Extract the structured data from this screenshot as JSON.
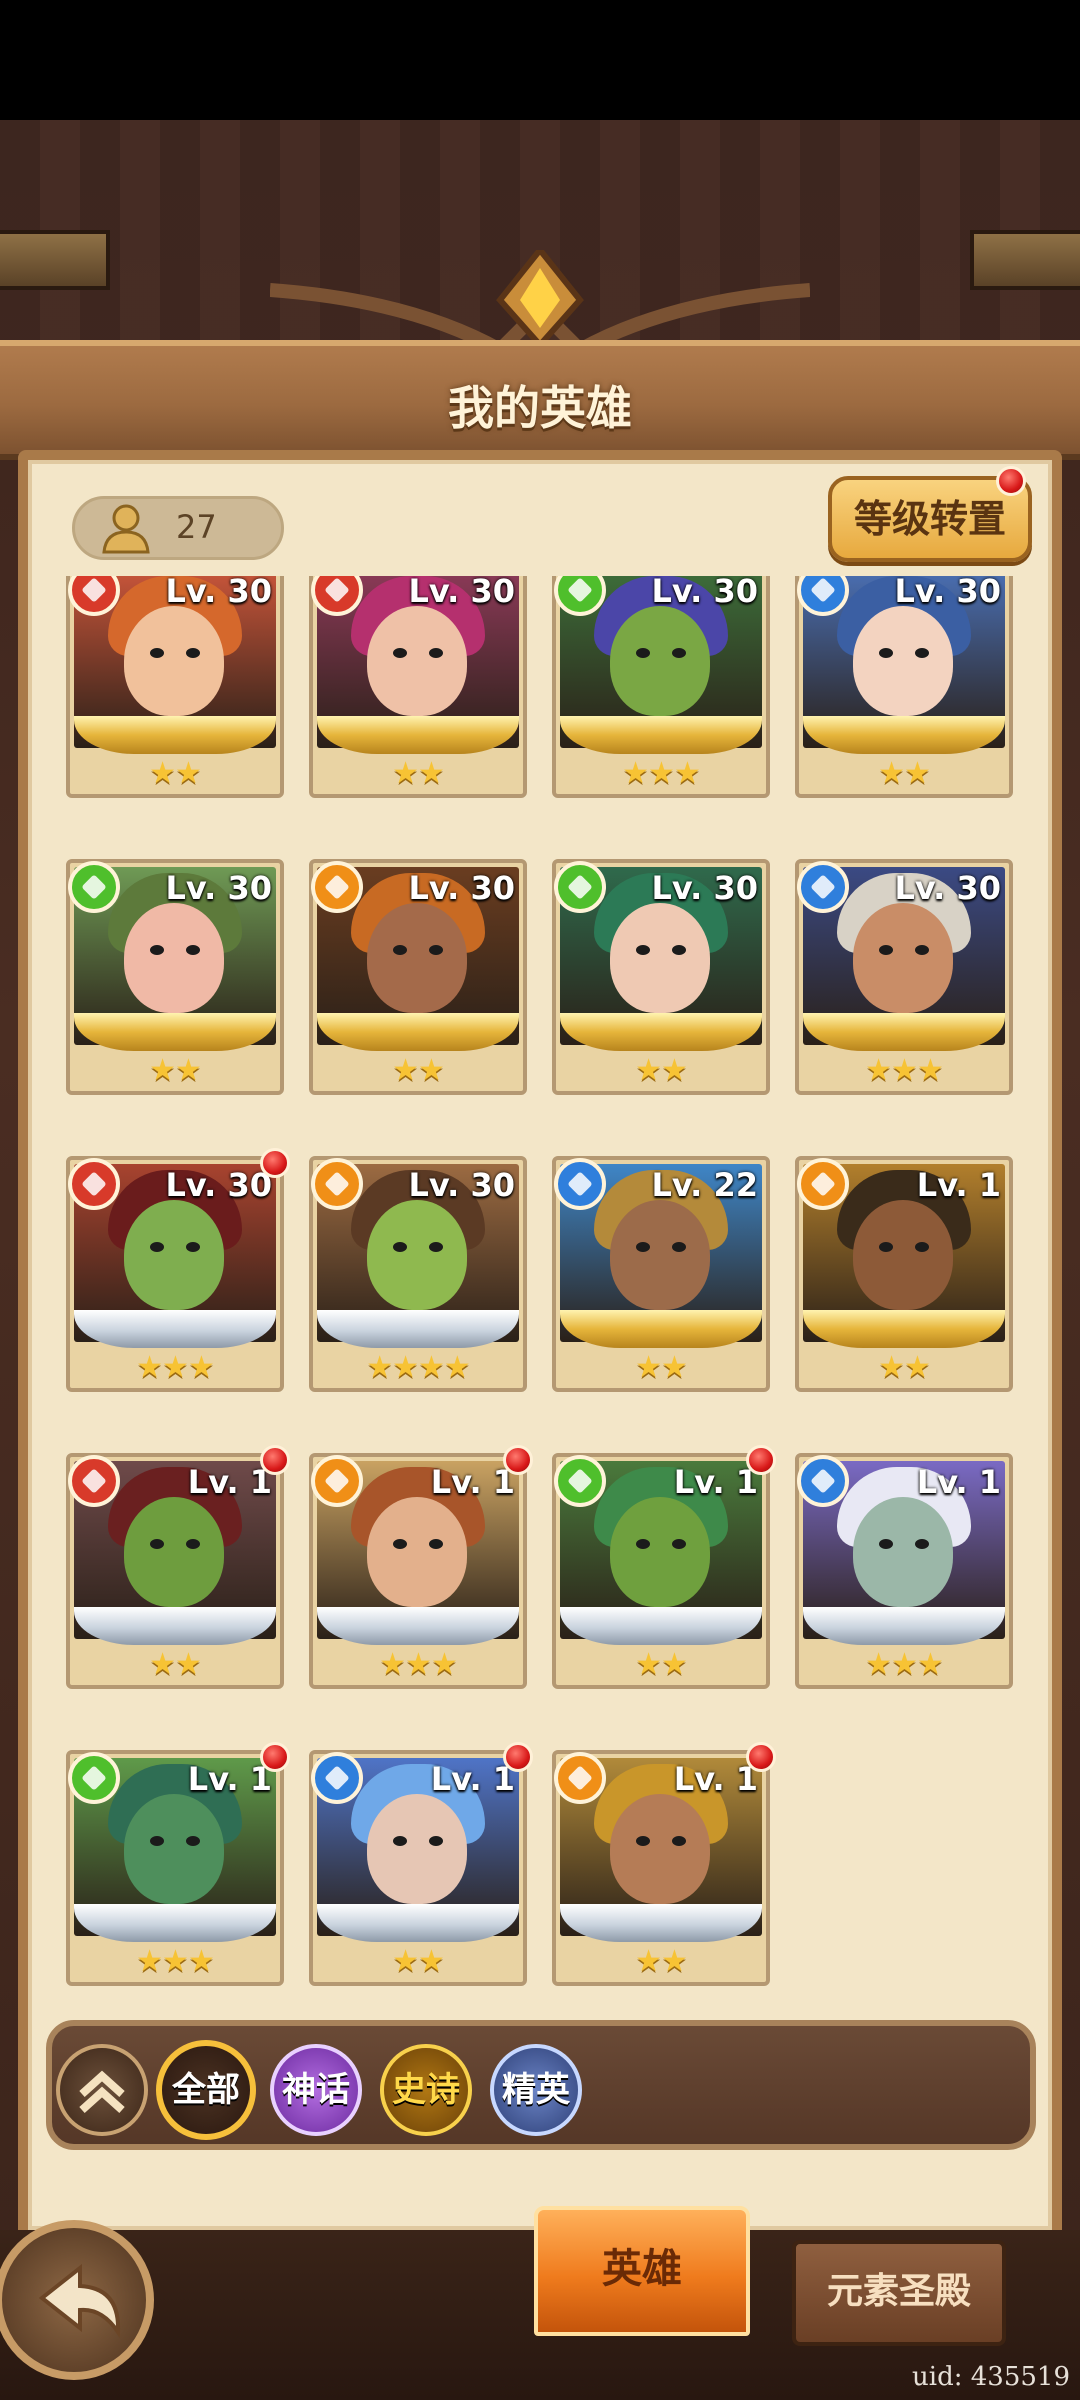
{
  "header": {
    "title": "我的英雄"
  },
  "hero_count": "27",
  "reset_button": {
    "label": "等级转置",
    "has_badge": true
  },
  "elements": {
    "fire": "#d83a2a",
    "earth": "#f08f17",
    "wind": "#4fbf2c",
    "water": "#2f7fdc"
  },
  "heroes": [
    {
      "level": "Lv. 30",
      "element": "fire",
      "stars": "★★",
      "frame": "gold",
      "badge": false,
      "hair": "#d5682c",
      "skin": "#f1c19b",
      "bg": "#c8553a"
    },
    {
      "level": "Lv. 30",
      "element": "fire",
      "stars": "★★",
      "frame": "gold",
      "badge": false,
      "hair": "#b5306e",
      "skin": "#efc1a7",
      "bg": "#8c3a58"
    },
    {
      "level": "Lv. 30",
      "element": "wind",
      "stars": "★★★",
      "frame": "gold",
      "badge": false,
      "hair": "#4b46a8",
      "skin": "#7aa744",
      "bg": "#3d6e3a"
    },
    {
      "level": "Lv. 30",
      "element": "water",
      "stars": "★★",
      "frame": "gold",
      "badge": false,
      "hair": "#3b5fa3",
      "skin": "#f3d3c0",
      "bg": "#4a6fb3"
    },
    {
      "level": "Lv. 30",
      "element": "wind",
      "stars": "★★",
      "frame": "gold",
      "badge": false,
      "hair": "#5d7a3b",
      "skin": "#f0b9a6",
      "bg": "#6f9a55"
    },
    {
      "level": "Lv. 30",
      "element": "earth",
      "stars": "★★",
      "frame": "gold",
      "badge": false,
      "hair": "#c86a23",
      "skin": "#a46a4a",
      "bg": "#6a3d20"
    },
    {
      "level": "Lv. 30",
      "element": "wind",
      "stars": "★★",
      "frame": "gold",
      "badge": false,
      "hair": "#2c7a56",
      "skin": "#efc9b3",
      "bg": "#2f6a4c"
    },
    {
      "level": "Lv. 30",
      "element": "water",
      "stars": "★★★",
      "frame": "gold",
      "badge": false,
      "hair": "#d8d2c6",
      "skin": "#c98d67",
      "bg": "#3b4a84"
    },
    {
      "level": "Lv. 30",
      "element": "fire",
      "stars": "★★★",
      "frame": "silver",
      "badge": true,
      "hair": "#6a1c1c",
      "skin": "#7fae4f",
      "bg": "#a8432f"
    },
    {
      "level": "Lv. 30",
      "element": "earth",
      "stars": "★★★★",
      "frame": "silver",
      "badge": false,
      "hair": "#5b3a24",
      "skin": "#8fb94f",
      "bg": "#9c6b42"
    },
    {
      "level": "Lv. 22",
      "element": "water",
      "stars": "★★",
      "frame": "gold",
      "badge": false,
      "hair": "#b48a3a",
      "skin": "#9c6b4a",
      "bg": "#3f86c7"
    },
    {
      "level": "Lv. 1",
      "element": "earth",
      "stars": "★★",
      "frame": "gold",
      "badge": false,
      "hair": "#3a2b1a",
      "skin": "#8d5a38",
      "bg": "#b27f2c"
    },
    {
      "level": "Lv. 1",
      "element": "fire",
      "stars": "★★",
      "frame": "silver",
      "badge": true,
      "hair": "#6a2020",
      "skin": "#6e9d3e",
      "bg": "#6f4a4a"
    },
    {
      "level": "Lv. 1",
      "element": "earth",
      "stars": "★★★",
      "frame": "silver",
      "badge": true,
      "hair": "#a8552a",
      "skin": "#e3b08c",
      "bg": "#c9a262"
    },
    {
      "level": "Lv. 1",
      "element": "wind",
      "stars": "★★",
      "frame": "silver",
      "badge": true,
      "hair": "#3e8a4a",
      "skin": "#6fa03e",
      "bg": "#4a7a3c"
    },
    {
      "level": "Lv. 1",
      "element": "water",
      "stars": "★★★",
      "frame": "silver",
      "badge": false,
      "hair": "#e8e8f4",
      "skin": "#9bb7a8",
      "bg": "#7a6ac4"
    },
    {
      "level": "Lv. 1",
      "element": "wind",
      "stars": "★★★",
      "frame": "silver",
      "badge": true,
      "hair": "#2f6e54",
      "skin": "#4e8f5c",
      "bg": "#5f9a4a"
    },
    {
      "level": "Lv. 1",
      "element": "water",
      "stars": "★★",
      "frame": "silver",
      "badge": true,
      "hair": "#6fa8e8",
      "skin": "#e6c6b4",
      "bg": "#4f74c7"
    },
    {
      "level": "Lv. 1",
      "element": "earth",
      "stars": "★★",
      "frame": "silver",
      "badge": true,
      "hair": "#c9962a",
      "skin": "#b57c56",
      "bg": "#b18a3a"
    }
  ],
  "filters": [
    {
      "label": "全部",
      "selected": true
    },
    {
      "label": "神话",
      "selected": false
    },
    {
      "label": "史诗",
      "selected": false
    },
    {
      "label": "精英",
      "selected": false
    }
  ],
  "bottom_tabs": {
    "heroes": "英雄",
    "temple": "元素圣殿"
  },
  "uid": "uid: 435519"
}
